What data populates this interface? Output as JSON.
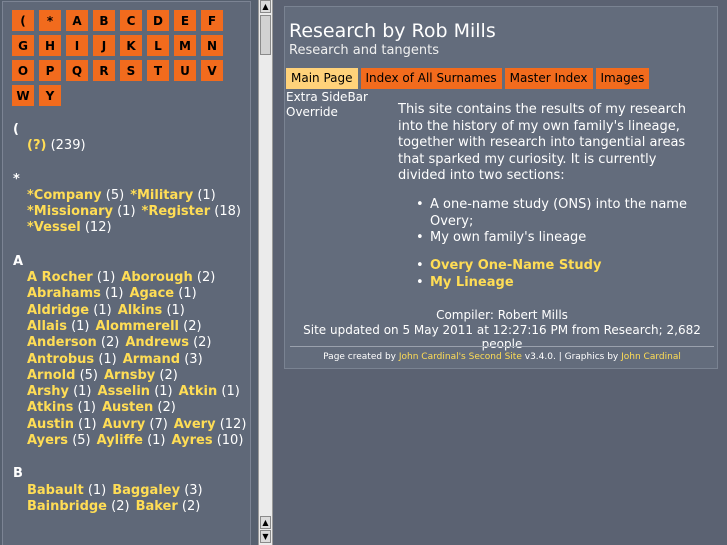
{
  "alphabet": [
    "(",
    "*",
    "A",
    "B",
    "C",
    "D",
    "E",
    "F",
    "G",
    "H",
    "I",
    "J",
    "K",
    "L",
    "M",
    "N",
    "O",
    "P",
    "Q",
    "R",
    "S",
    "T",
    "U",
    "V",
    "W",
    "Y"
  ],
  "index": [
    {
      "heading": "(",
      "rows": [
        [
          {
            "name": "(?)",
            "count": "(239)"
          }
        ]
      ]
    },
    {
      "heading": "*",
      "rows": [
        [
          {
            "name": "*Company",
            "count": "(5)"
          },
          {
            "name": "*Military",
            "count": "(1)"
          }
        ],
        [
          {
            "name": "*Missionary",
            "count": "(1)"
          },
          {
            "name": "*Register",
            "count": "(18)"
          }
        ],
        [
          {
            "name": "*Vessel",
            "count": "(12)"
          }
        ]
      ]
    },
    {
      "heading": "A",
      "rows": [
        [
          {
            "name": "A Rocher",
            "count": "(1)"
          },
          {
            "name": "Aborough",
            "count": "(2)"
          }
        ],
        [
          {
            "name": "Abrahams",
            "count": "(1)"
          },
          {
            "name": "Agace",
            "count": "(1)"
          }
        ],
        [
          {
            "name": "Aldridge",
            "count": "(1)"
          },
          {
            "name": "Alkins",
            "count": "(1)"
          }
        ],
        [
          {
            "name": "Allais",
            "count": "(1)"
          },
          {
            "name": "Alommerell",
            "count": "(2)"
          }
        ],
        [
          {
            "name": "Anderson",
            "count": "(2)"
          },
          {
            "name": "Andrews",
            "count": "(2)"
          }
        ],
        [
          {
            "name": "Antrobus",
            "count": "(1)"
          },
          {
            "name": "Armand",
            "count": "(3)"
          }
        ],
        [
          {
            "name": "Arnold",
            "count": "(5)"
          },
          {
            "name": "Arnsby",
            "count": "(2)"
          }
        ],
        [
          {
            "name": "Arshy",
            "count": "(1)"
          },
          {
            "name": "Asselin",
            "count": "(1)"
          },
          {
            "name": "Atkin",
            "count": "(1)"
          }
        ],
        [
          {
            "name": "Atkins",
            "count": "(1)"
          },
          {
            "name": "Austen",
            "count": "(2)"
          }
        ],
        [
          {
            "name": "Austin",
            "count": "(1)"
          },
          {
            "name": "Auvry",
            "count": "(7)"
          },
          {
            "name": "Avery",
            "count": "(12)"
          }
        ],
        [
          {
            "name": "Ayers",
            "count": "(5)"
          },
          {
            "name": "Ayliffe",
            "count": "(1)"
          },
          {
            "name": "Ayres",
            "count": "(10)"
          }
        ]
      ]
    },
    {
      "heading": "B",
      "rows": [
        [
          {
            "name": "Babault",
            "count": "(1)"
          },
          {
            "name": "Baggaley",
            "count": "(3)"
          }
        ],
        [
          {
            "name": "Bainbridge",
            "count": "(2)"
          },
          {
            "name": "Baker",
            "count": "(2)"
          }
        ]
      ]
    }
  ],
  "site": {
    "title": "Research by Rob Mills",
    "subtitle": "Research and tangents"
  },
  "tabs": [
    {
      "label": "Main Page",
      "active": true
    },
    {
      "label": "Index of All Surnames",
      "active": false
    },
    {
      "label": "Master Index",
      "active": false
    },
    {
      "label": "Images",
      "active": false
    }
  ],
  "sidebar_note": [
    "Extra SideBar",
    "Override"
  ],
  "intro": "This site contains the results of my research into the history of my own family's lineage, together with research into tangential areas that sparked my curiosity. It is currently divided into two sections:",
  "sections": [
    "A one-name study (ONS) into the name Overy;",
    "My own family's lineage"
  ],
  "links": [
    "Overy One-Name Study",
    "My Lineage"
  ],
  "compiler": "Compiler: Robert Mills",
  "updated": "Site updated on 5 May 2011 at 12:27:16 PM from Research; 2,682 people",
  "credits": {
    "prefix": "Page created by",
    "tool": "John Cardinal's Second Site",
    "version": "v3.4.0.  |  Graphics by",
    "graphics": "John Cardinal"
  },
  "colors": {
    "accent": "#f26b1d",
    "link": "#ffdd55",
    "active_tab": "#ffd27a",
    "background": "#5b6272"
  },
  "icons": {
    "scroll_up": "triangle-up",
    "scroll_down": "triangle-down"
  }
}
